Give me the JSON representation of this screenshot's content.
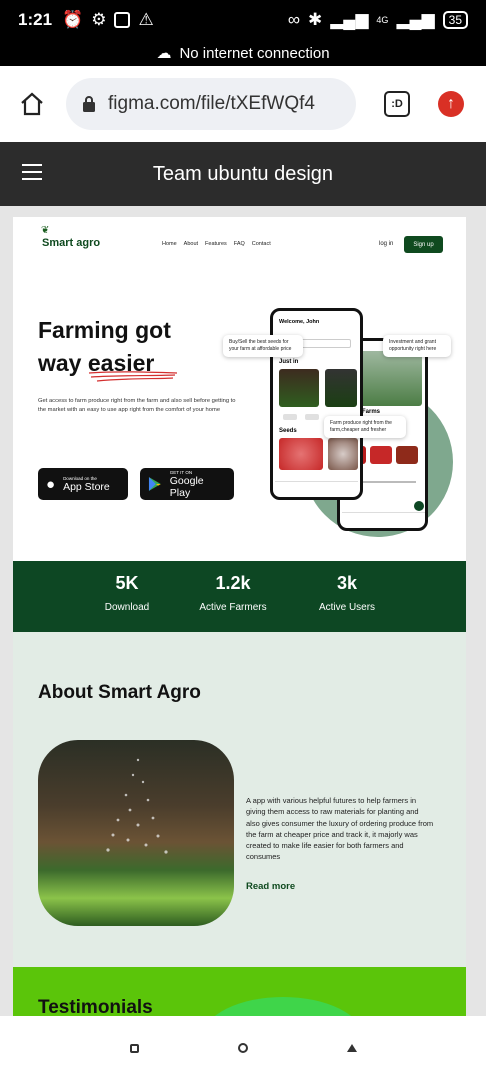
{
  "status_bar": {
    "time": "1:21",
    "network_label": "4G",
    "battery": "35"
  },
  "offline_banner": {
    "text": "No internet connection"
  },
  "browser": {
    "url": "figma.com/file/tXEfWQf4",
    "tab_label": ":D"
  },
  "figma": {
    "file_title": "Team ubuntu design"
  },
  "design": {
    "logo": "Smart agro",
    "nav_links": [
      "Home",
      "About",
      "Features",
      "FAQ",
      "Contact"
    ],
    "login": "log in",
    "signup": "Sign up",
    "hero": {
      "title_line1": "Farming got",
      "title_line2_a": "way ",
      "title_line2_b": "easier",
      "description": "Get access to farm produce right from the farm and also sell before getting to the market with an easy to use app right from the comfort of your home"
    },
    "app_store": {
      "small": "Download on the",
      "big": "App Store"
    },
    "google_play": {
      "small": "GET IT ON",
      "big": "Google Play"
    },
    "phone": {
      "welcome": "Welcome, John",
      "just_in": "Just in",
      "seeds": "Seeds",
      "farms": "Farms"
    },
    "popups": {
      "buy_sell": "Buy/Sell the best seeds for your farm at affordable price",
      "investment": "Investment and grant opportunity right here",
      "farm_produce": "Farm produce right from the farm,cheaper and fresher"
    },
    "stats": [
      {
        "num": "5K",
        "label": "Download"
      },
      {
        "num": "1.2k",
        "label": "Active Farmers"
      },
      {
        "num": "3k",
        "label": "Active Users"
      }
    ],
    "about": {
      "title": "About Smart Agro",
      "text": "A app with  various helpful futures to help farmers in giving them access to raw materials for planting and also gives consumer the luxury of ordering produce from the farm at cheaper price and track it, it majorly was created to make life easier  for both farmers and consumes",
      "read_more": "Read more"
    },
    "testimonials": {
      "title": "Testimonials"
    }
  },
  "colors": {
    "brand_green": "#0d4723",
    "about_bg": "#e2ece5",
    "testimonials_bg": "#5bc50a"
  }
}
